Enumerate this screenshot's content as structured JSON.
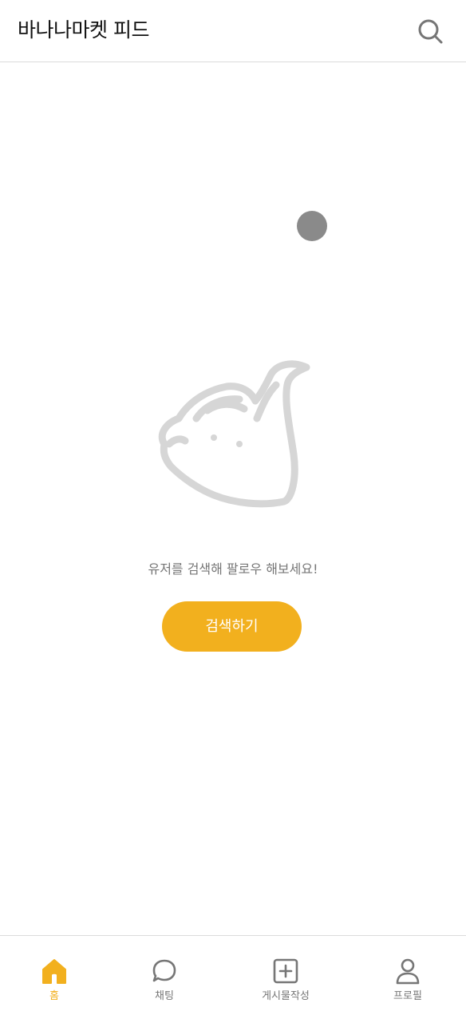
{
  "header": {
    "title": "바나나마켓 피드",
    "search_icon": "search-icon"
  },
  "empty_state": {
    "illustration": "mascot-outline-icon",
    "message": "유저를 검색해 팔로우 해보세요!",
    "button_label": "검색하기"
  },
  "tabbar": {
    "active": "home",
    "items": [
      {
        "key": "home",
        "label": "홈",
        "icon": "home-icon"
      },
      {
        "key": "chat",
        "label": "채팅",
        "icon": "chat-bubble-icon"
      },
      {
        "key": "post",
        "label": "게시물작성",
        "icon": "plus-square-icon"
      },
      {
        "key": "profile",
        "label": "프로필",
        "icon": "user-icon"
      }
    ]
  },
  "colors": {
    "accent": "#f2b01e",
    "text_muted": "#767676",
    "border": "#dbdbdb",
    "loading_dot": "#8a8a8a",
    "illustration": "#d6d6d6"
  }
}
